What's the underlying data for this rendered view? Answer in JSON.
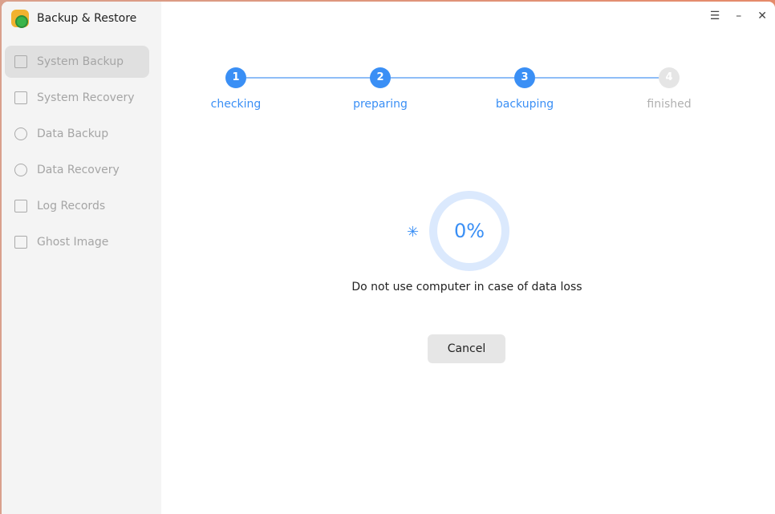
{
  "app": {
    "title": "Backup & Restore"
  },
  "sidebar": {
    "items": [
      {
        "label": "System Backup",
        "icon": "system-backup-icon",
        "active": true
      },
      {
        "label": "System Recovery",
        "icon": "system-recovery-icon"
      },
      {
        "label": "Data Backup",
        "icon": "data-backup-icon"
      },
      {
        "label": "Data Recovery",
        "icon": "data-recovery-icon"
      },
      {
        "label": "Log Records",
        "icon": "log-records-icon"
      },
      {
        "label": "Ghost Image",
        "icon": "ghost-image-icon"
      }
    ]
  },
  "window_controls": {
    "menu": "☰",
    "minimize": "–",
    "close": "✕"
  },
  "steps": [
    {
      "number": "1",
      "label": "checking",
      "state": "done"
    },
    {
      "number": "2",
      "label": "preparing",
      "state": "done"
    },
    {
      "number": "3",
      "label": "backuping",
      "state": "current"
    },
    {
      "number": "4",
      "label": "finished",
      "state": "pending"
    }
  ],
  "progress": {
    "percent_text": "0%",
    "value": 0,
    "spinner": "✳"
  },
  "message": "Do not use computer in case of data loss",
  "cancel_label": "Cancel",
  "colors": {
    "accent": "#3a8ff5",
    "ring": "#dbe9fd"
  }
}
